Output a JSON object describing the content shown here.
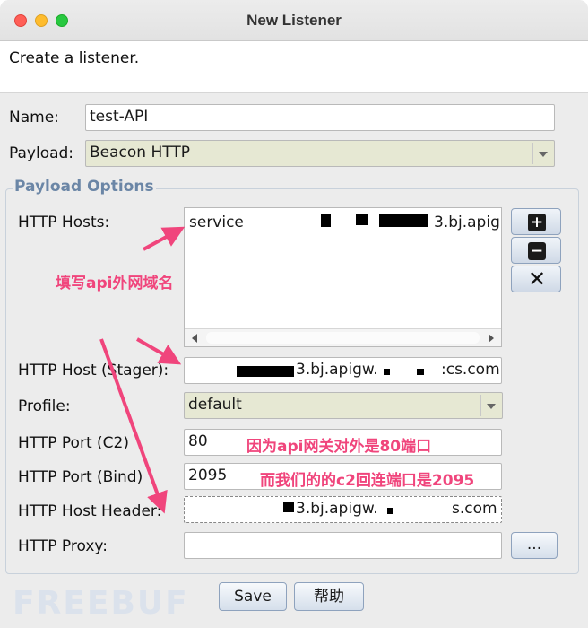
{
  "window": {
    "title": "New Listener"
  },
  "banner": {
    "text": "Create a listener."
  },
  "form": {
    "name_label": "Name:",
    "name_value": "test-API",
    "payload_label": "Payload:",
    "payload_value": "Beacon HTTP",
    "payload_options_title": "Payload Options",
    "http_hosts_label": "HTTP Hosts:",
    "http_hosts_value": "service",
    "http_hosts_value_tail": "3.bj.apig",
    "http_host_stager_label": "HTTP Host (Stager):",
    "http_host_stager_value_mid": "3.bj.apigw.",
    "http_host_stager_value_tail": ":cs.com",
    "profile_label": "Profile:",
    "profile_value": "default",
    "http_port_c2_label": "HTTP Port (C2)",
    "http_port_c2_value": "80",
    "http_port_bind_label": "HTTP Port (Bind)",
    "http_port_bind_value": "2095",
    "http_host_header_label": "HTTP Host Header:",
    "http_host_header_value_mid": "3.bj.apigw.",
    "http_host_header_value_tail": "s.com",
    "http_proxy_label": "HTTP Proxy:",
    "http_proxy_value": "",
    "proxy_button_label": "..."
  },
  "side_buttons": [
    {
      "icon": "plus-icon",
      "glyph": "+"
    },
    {
      "icon": "minus-icon",
      "glyph": "−"
    },
    {
      "icon": "close-icon",
      "glyph": "✕"
    }
  ],
  "buttons": {
    "save": "Save",
    "help": "帮助"
  },
  "annotations": {
    "domain_note": "填写api外网域名",
    "port_note": "因为api网关对外是80端口",
    "c2_note": "而我们的的c2回连端口是2095"
  },
  "watermark": "FREEBUF",
  "colors": {
    "annotation": "#f0457c",
    "group_title": "#6b86a6",
    "select_bg": "#e6e8d3"
  }
}
